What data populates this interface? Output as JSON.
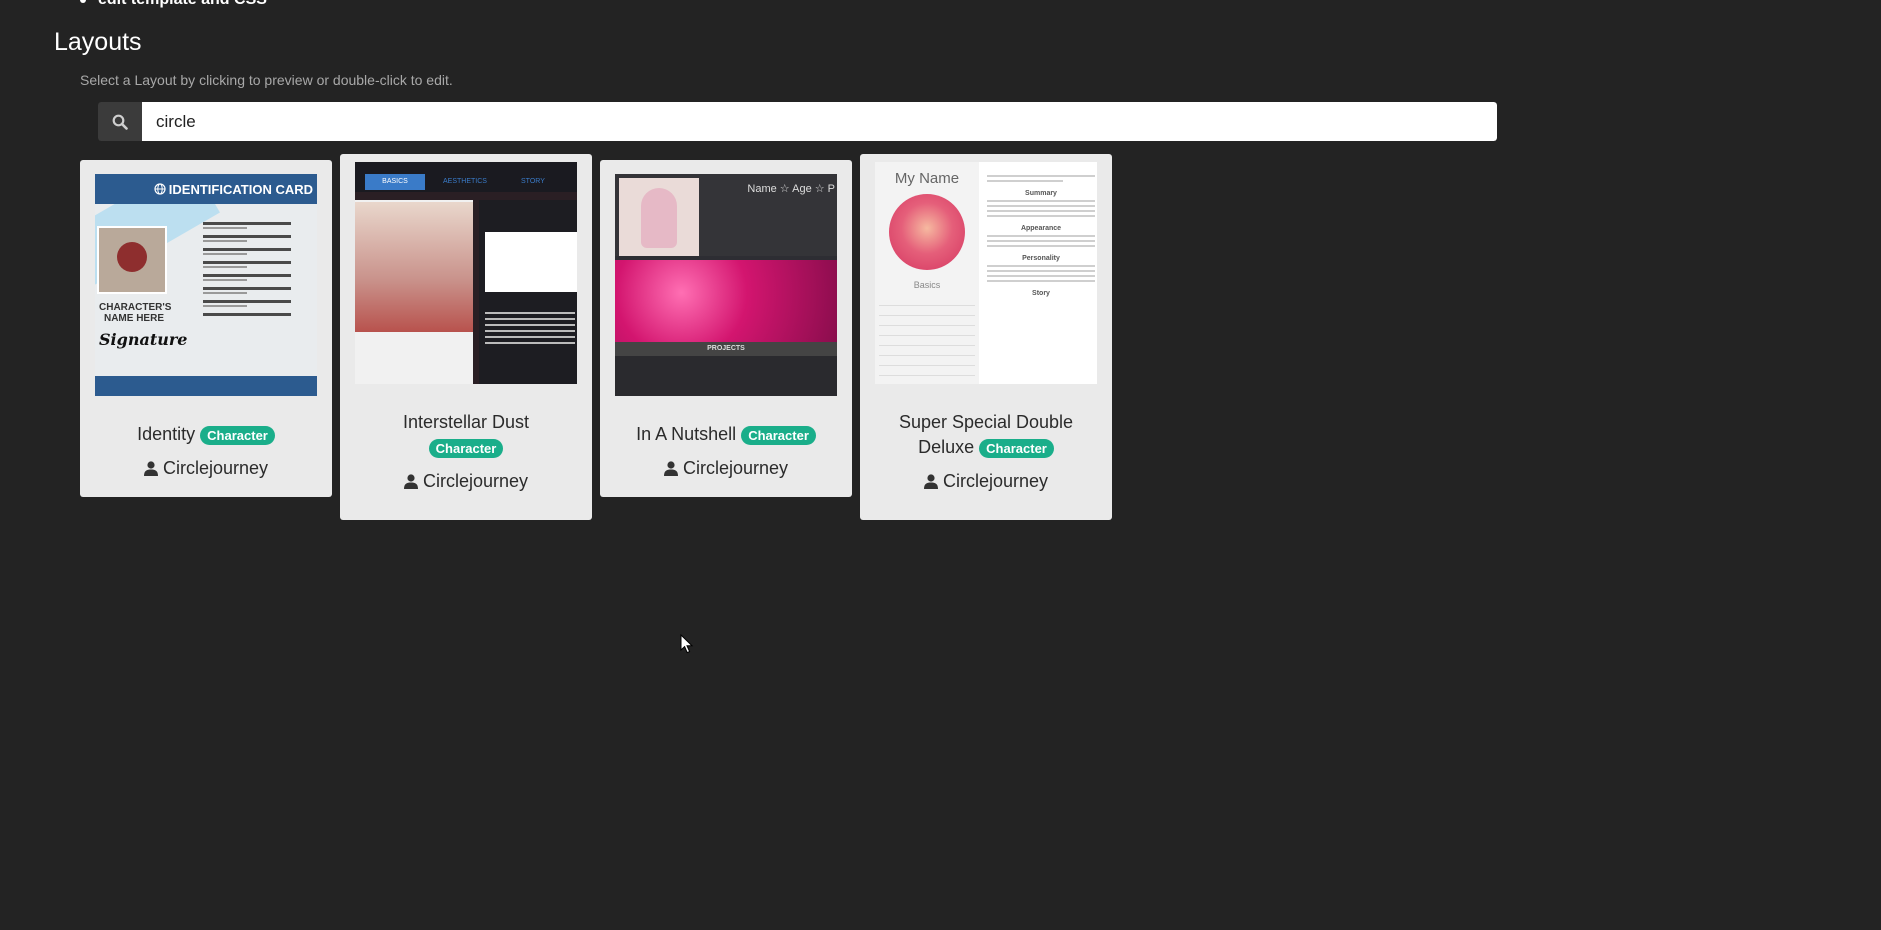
{
  "page": {
    "prev_bullet": "edit template and CSS",
    "section_title": "Layouts",
    "section_help": "Select a Layout by clicking to preview or double-click to edit."
  },
  "search": {
    "value": "circle",
    "icon": "search-icon"
  },
  "cards": [
    {
      "title": "Identity",
      "badge": "Character",
      "author": "Circlejourney",
      "thumb": {
        "header": "IDENTIFICATION CARD",
        "name_line": "CHARACTER'S NAME HERE",
        "signature": "Signature"
      }
    },
    {
      "title": "Interstellar Dust",
      "badge": "Character",
      "author": "Circlejourney",
      "thumb": {
        "tab1": "BASICS",
        "tab2": "AESTHETICS",
        "tab3": "STORY"
      }
    },
    {
      "title": "In A Nutshell",
      "badge": "Character",
      "author": "Circlejourney",
      "thumb": {
        "name_line": "Name ☆ Age ☆ P",
        "projects": "PROJECTS"
      }
    },
    {
      "title": "Super Special Double Deluxe",
      "badge": "Character",
      "author": "Circlejourney",
      "thumb": {
        "name": "My Name",
        "basics": "Basics",
        "summary": "Summary",
        "appearance": "Appearance",
        "personality": "Personality",
        "story": "Story"
      }
    }
  ],
  "colors": {
    "background": "#232323",
    "card": "#eaeaea",
    "badge": "#1aae8a"
  }
}
